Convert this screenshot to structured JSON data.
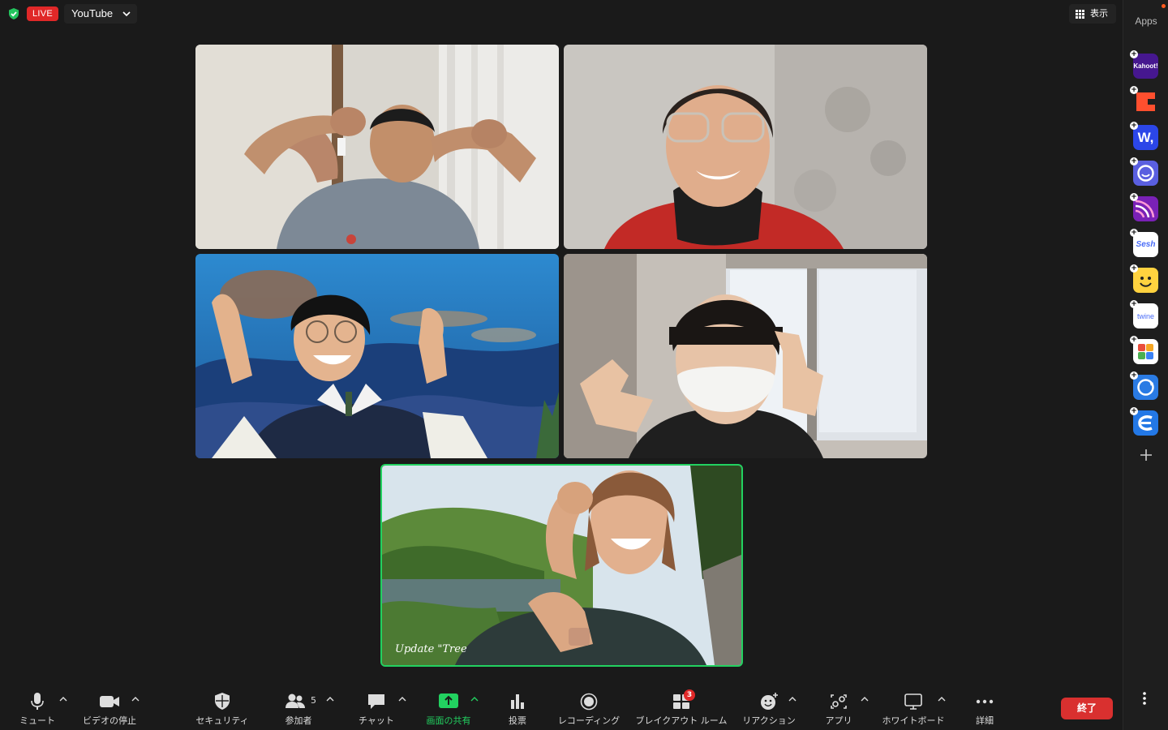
{
  "topbar": {
    "live_label": "LIVE",
    "stream_target": "YouTube",
    "view_label": "表示"
  },
  "apps_panel": {
    "title": "Apps",
    "apps": [
      {
        "name": "kahoot",
        "label": "Kahoot!",
        "bg": "#46178f",
        "fg": "#ffffff"
      },
      {
        "name": "coda",
        "label": "",
        "bg": "#ffffff",
        "fg": "#ff4f2e"
      },
      {
        "name": "wooclap",
        "label": "W,",
        "bg": "#2b46e8",
        "fg": "#ffffff"
      },
      {
        "name": "mmhmm",
        "label": "",
        "bg": "#5a5fe0",
        "fg": "#ffffff"
      },
      {
        "name": "virtual-venue",
        "label": "",
        "bg": "#7a21b6",
        "fg": "#ffffff"
      },
      {
        "name": "sesh",
        "label": "Sesh",
        "bg": "#ffffff",
        "fg": "#4a6cf7"
      },
      {
        "name": "emoji-app",
        "label": "",
        "bg": "#ffd23f",
        "fg": "#000000"
      },
      {
        "name": "twine",
        "label": "twine",
        "bg": "#ffffff",
        "fg": "#4a6cf7"
      },
      {
        "name": "collab-app",
        "label": "",
        "bg": "#ffffff",
        "fg": "#000000"
      },
      {
        "name": "sync-app",
        "label": "",
        "bg": "#2a7be4",
        "fg": "#ffffff"
      },
      {
        "name": "e-app",
        "label": "",
        "bg": "#2378e6",
        "fg": "#ffffff"
      }
    ]
  },
  "toolbar": {
    "mute": "ミュート",
    "stop_video": "ビデオの停止",
    "security": "セキュリティ",
    "participants": "参加者",
    "participants_count": "5",
    "chat": "チャット",
    "share_screen": "画面の共有",
    "poll": "投票",
    "recording": "レコーディング",
    "breakout": "ブレイクアウト ルーム",
    "breakout_badge": "3",
    "reactions": "リアクション",
    "apps": "アプリ",
    "whiteboard": "ホワイトボード",
    "details": "詳細",
    "end": "終了"
  },
  "video_tiles": [
    {
      "name": "participant-1",
      "active_speaker": false
    },
    {
      "name": "participant-2",
      "active_speaker": false
    },
    {
      "name": "participant-3",
      "active_speaker": false
    },
    {
      "name": "participant-4",
      "active_speaker": false
    },
    {
      "name": "participant-5",
      "active_speaker": true,
      "overlay_text": "Update \"Tree"
    }
  ],
  "colors": {
    "live": "#e02828",
    "active_speaker_border": "#22d160",
    "share_green": "#22d160",
    "end_red": "#d9302f",
    "badge_red": "#e02828"
  }
}
